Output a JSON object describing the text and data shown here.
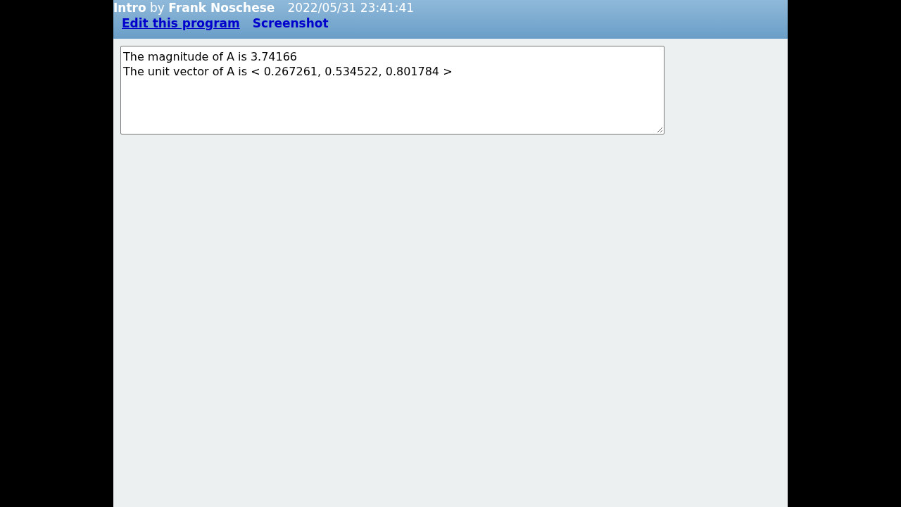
{
  "header": {
    "title": "**Intro** by **Frank Noschese**",
    "timestamp": "2022/05/31 23:41:41",
    "links": [
      "Edit this program",
      "Screenshot"
    ]
  },
  "output": {
    "lines": [
      "The magnitude of A is 3.74166",
      "The unit vector of A is < 0.267261, 0.534522, 0.801784 >"
    ]
  }
}
